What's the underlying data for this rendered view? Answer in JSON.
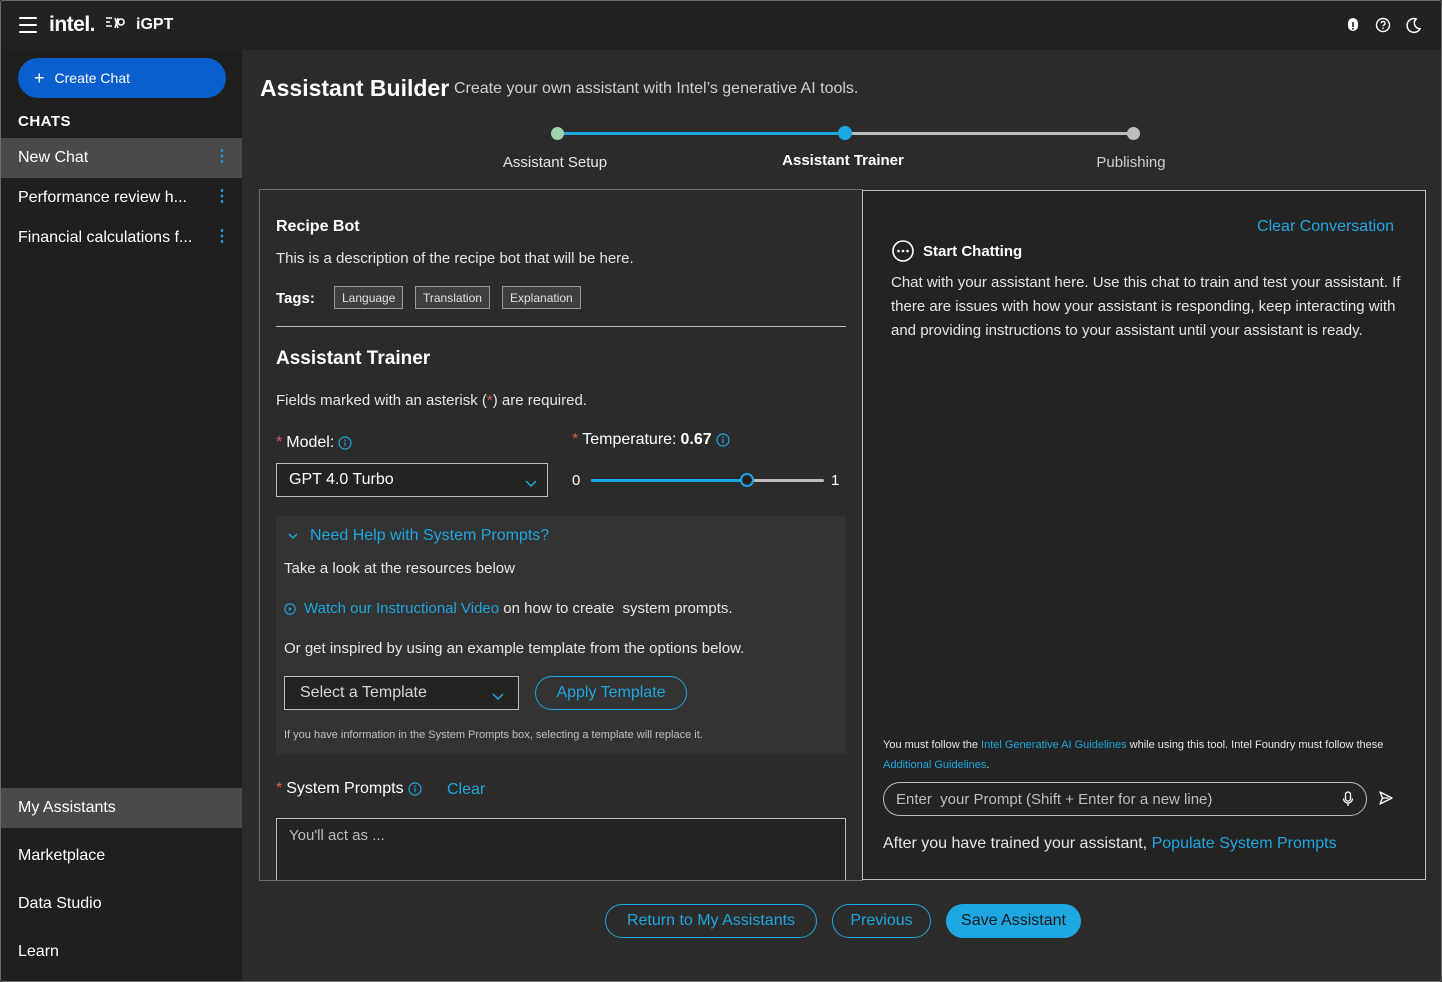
{
  "brand": {
    "logo_text": "intel.",
    "product": "iGPT"
  },
  "header": {
    "icons": [
      "bug-report-icon",
      "help-icon",
      "dark-mode-icon"
    ]
  },
  "sidebar": {
    "create_chat": "Create Chat",
    "chats_heading": "CHATS",
    "chats": [
      {
        "label": "New Chat",
        "active": true
      },
      {
        "label": "Performance review h...",
        "active": false
      },
      {
        "label": "Financial calculations f...",
        "active": false
      }
    ],
    "nav": [
      {
        "label": "My Assistants",
        "active": true
      },
      {
        "label": "Marketplace",
        "active": false
      },
      {
        "label": "Data Studio",
        "active": false
      },
      {
        "label": "Learn",
        "active": false
      }
    ]
  },
  "page": {
    "title": "Assistant Builder",
    "subtitle": "Create your own assistant  with Intel’s generative AI tools."
  },
  "stepper": {
    "steps": [
      {
        "label": "Assistant Setup",
        "state": "complete"
      },
      {
        "label": "Assistant Trainer",
        "state": "current"
      },
      {
        "label": "Publishing",
        "state": "upcoming"
      }
    ],
    "colors": {
      "complete": "#9bd3ad",
      "current": "#1ea7e0",
      "upcoming": "#bdbdbd"
    }
  },
  "bot": {
    "name": "Recipe Bot",
    "description": "This is a description of the recipe bot that will be here.",
    "tags_label": "Tags:",
    "tags": [
      "Language",
      "Translation",
      "Explanation"
    ]
  },
  "trainer": {
    "title": "Assistant Trainer",
    "required_note_prefix": "Fields marked with an asterisk (",
    "required_note_asterisk": "*",
    "required_note_suffix": ") are required.",
    "asterisk": "*",
    "model_label": "Model:",
    "model_value": "GPT 4.0 Turbo",
    "temperature_label": "Temperature:",
    "temperature_value": "0.67",
    "temperature_fraction": 0.67,
    "slider_min": "0",
    "slider_max": "1",
    "help": {
      "toggle": "Need Help with System Prompts?",
      "line1": "Take a look at the resources below",
      "video_link": "Watch our Instructional Video",
      "video_suffix": " on how to create  system prompts.",
      "line3": "Or get inspired by using an example template from the options below.",
      "template_placeholder": "Select a Template",
      "apply": "Apply Template",
      "note": "If you have information in the System Prompts box, selecting a template will replace it."
    },
    "system_prompts_label": "System Prompts",
    "system_prompts_clear": "Clear",
    "system_prompts_placeholder": "You'll act as ..."
  },
  "chat": {
    "clear": "Clear Conversation",
    "start": "Start Chatting",
    "description": "Chat with your assistant here. Use this chat to train and test your assistant. If there are issues with how your assistant is responding, keep interacting with and providing instructions to your assistant until your assistant is ready.",
    "guide_prefix": "You must follow the ",
    "guide_link1": "Intel Generative AI Guidelines",
    "guide_mid": " while using this tool. Intel Foundry must follow these ",
    "guide_link2": "Additional Guidelines",
    "guide_suffix": ".",
    "prompt_placeholder": "Enter  your Prompt (Shift + Enter for a new line)",
    "populate_prefix": "After you have trained your assistant, ",
    "populate_link": "Populate System Prompts"
  },
  "footer": {
    "return": "Return to My Assistants",
    "previous": "Previous",
    "save": "Save Assistant"
  },
  "colors": {
    "accent": "#1ea7e0",
    "primary_button": "#0a5fcf",
    "required": "#e05a4f"
  }
}
